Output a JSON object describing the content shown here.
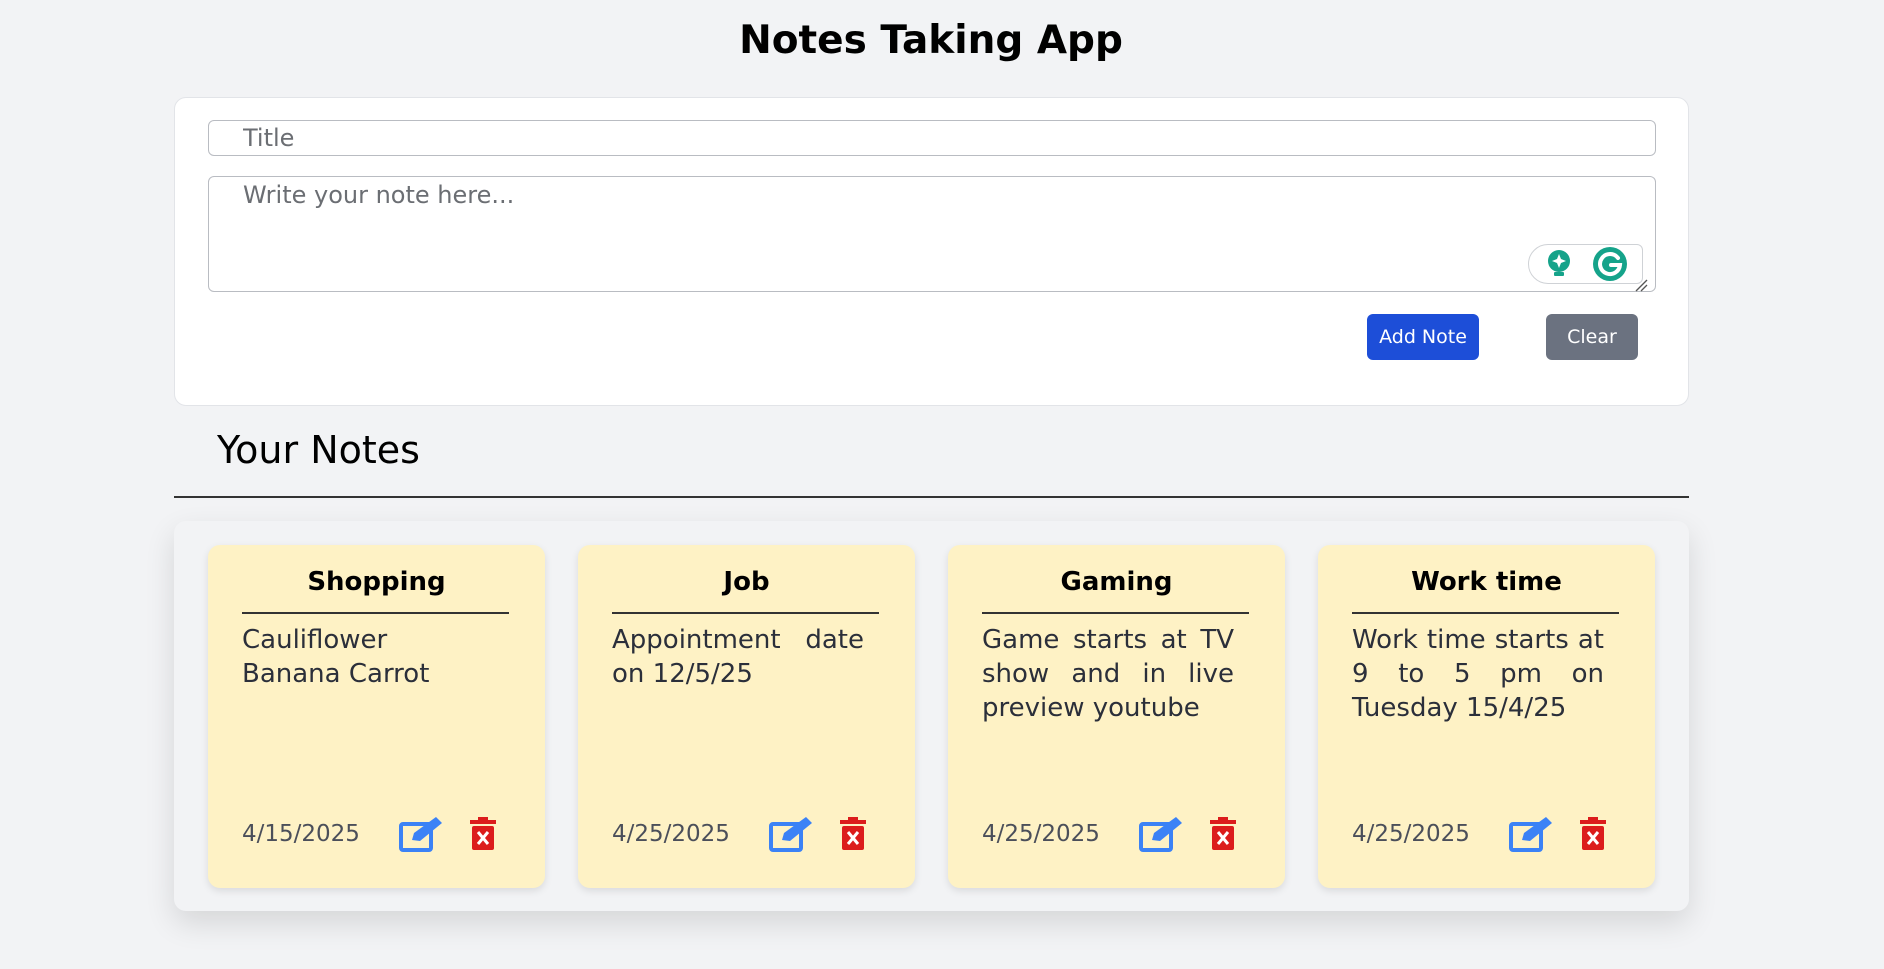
{
  "app": {
    "title": "Notes Taking App"
  },
  "form": {
    "title_placeholder": "Title",
    "title_value": "",
    "note_placeholder": "Write your note here...",
    "note_value": "",
    "add_label": "Add Note",
    "clear_label": "Clear"
  },
  "notes_section": {
    "heading": "Your Notes"
  },
  "notes": [
    {
      "title": "Shopping",
      "body": "Cauliflower Banana Carrot",
      "date": "4/15/2025"
    },
    {
      "title": "Job",
      "body": "Appointment date on 12/5/25",
      "date": "4/25/2025"
    },
    {
      "title": "Gaming",
      "body": "Game starts at TV show and in live preview youtube",
      "date": "4/25/2025"
    },
    {
      "title": "Work time",
      "body": "Work time starts at 9 to 5 pm on Tuesday 15/4/25",
      "date": "4/25/2025"
    }
  ],
  "icons": {
    "edit": "edit-icon",
    "delete": "trash-icon",
    "grammarly_assist": "lightbulb-icon",
    "grammarly": "grammarly-icon"
  },
  "colors": {
    "primary": "#1d4ed8",
    "secondary": "#6b7280",
    "note_bg": "#fef2c5",
    "edit": "#3b82f6",
    "delete": "#dc1c1c",
    "grammarly": "#15a38a"
  }
}
